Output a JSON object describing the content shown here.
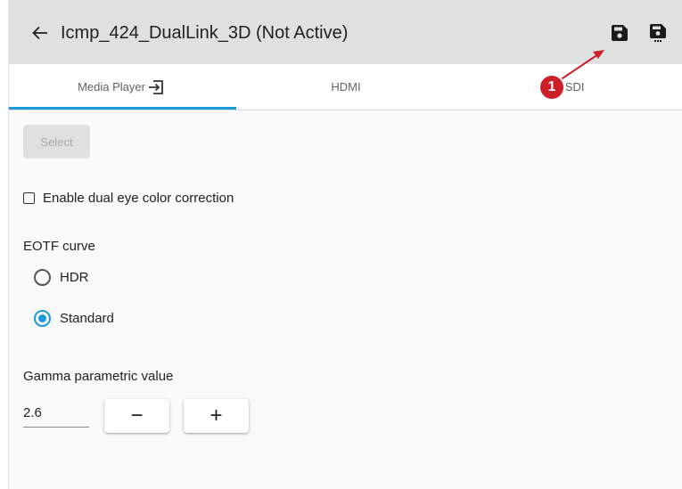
{
  "header": {
    "title": "Icmp_424_DualLink_3D (Not Active)",
    "back_icon": "arrow-left-icon",
    "save_icon": "floppy-disk-icon",
    "save_as_icon": "floppy-disk-more-icon",
    "background_color": "#e0e0e0"
  },
  "tabs": [
    {
      "label": "Media Player",
      "icon": "input-arrow-icon",
      "active": true
    },
    {
      "label": "HDMI",
      "active": false
    },
    {
      "label": "DSDI",
      "active": false
    }
  ],
  "accent_color": "#1a9ad6",
  "callout": {
    "number": "1",
    "color": "#cc1f2a"
  },
  "select_button": {
    "label": "Select",
    "disabled": true
  },
  "dual_eye": {
    "label": "Enable dual eye color correction",
    "checked": false
  },
  "eotf": {
    "label": "EOTF curve",
    "options": [
      {
        "label": "HDR",
        "selected": false
      },
      {
        "label": "Standard",
        "selected": true
      }
    ]
  },
  "gamma": {
    "label": "Gamma parametric value",
    "value": "2.6",
    "decrement_label": "−",
    "increment_label": "+"
  }
}
